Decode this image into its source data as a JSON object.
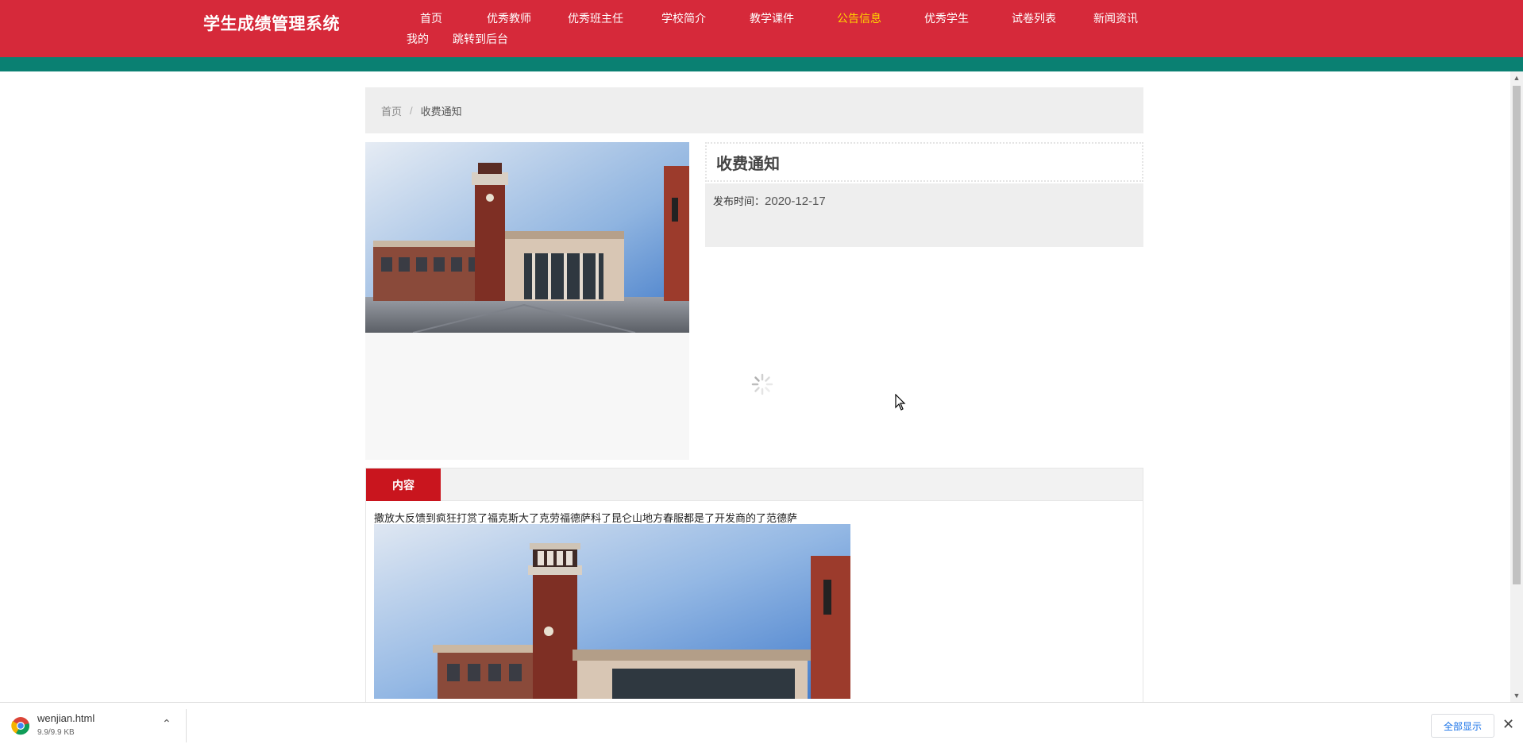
{
  "header": {
    "brand": "学生成绩管理系统",
    "nav": [
      {
        "label": "首页",
        "active": false
      },
      {
        "label": "优秀教师",
        "active": false
      },
      {
        "label": "优秀班主任",
        "active": false
      },
      {
        "label": "学校简介",
        "active": false
      },
      {
        "label": "教学课件",
        "active": false
      },
      {
        "label": "公告信息",
        "active": true
      },
      {
        "label": "优秀学生",
        "active": false
      },
      {
        "label": "试卷列表",
        "active": false
      },
      {
        "label": "新闻资讯",
        "active": false
      },
      {
        "label": "我的",
        "active": false
      },
      {
        "label": "跳转到后台",
        "active": false
      }
    ],
    "colors": {
      "primary": "#d6293a",
      "strip": "#0a8072",
      "active": "#ffd400"
    }
  },
  "breadcrumb": {
    "home": "首页",
    "separator": "/",
    "current": "收费通知"
  },
  "detail": {
    "title": "收费通知",
    "publish_label": "发布时间：",
    "publish_date": "2020-12-17"
  },
  "content": {
    "tab_label": "内容",
    "text": "撒放大反馈到疯狂打赏了福克斯大了克劳福德萨科了昆仑山地方春服都是了开发商的了范德萨",
    "tab_color": "#c9151e"
  },
  "download": {
    "file_name": "wenjian.html",
    "file_size": "9.9/9.9 KB",
    "show_all": "全部显示"
  }
}
